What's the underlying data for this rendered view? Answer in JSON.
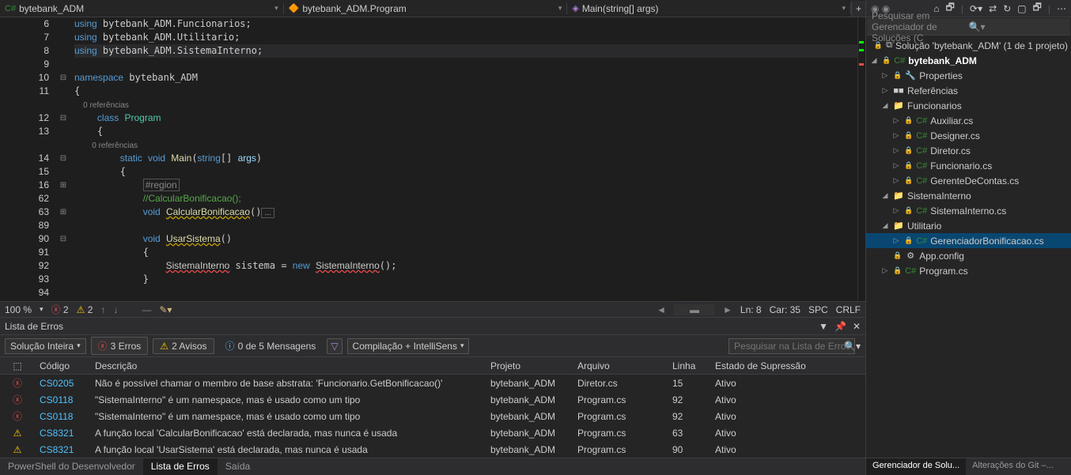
{
  "nav": {
    "project": "bytebank_ADM",
    "class": "bytebank_ADM.Program",
    "method": "Main(string[] args)"
  },
  "editor": {
    "lines": [
      {
        "n": 6,
        "t": "using bytebank_ADM.Funcionarios;",
        "k": "using"
      },
      {
        "n": 7,
        "t": "using bytebank_ADM.Utilitario;",
        "k": "using"
      },
      {
        "n": 8,
        "t": "using bytebank_ADM.SistemaInterno;",
        "k": "using",
        "cur": true,
        "bulb": true
      },
      {
        "n": 9,
        "t": ""
      },
      {
        "n": 10,
        "t": "namespace bytebank_ADM",
        "k": "ns"
      },
      {
        "n": 11,
        "t": "{"
      },
      {
        "n": "",
        "t": "    0 referências",
        "ref": true
      },
      {
        "n": 12,
        "t": "    class Program",
        "k": "cls"
      },
      {
        "n": 13,
        "t": "    {"
      },
      {
        "n": "",
        "t": "        0 referências",
        "ref": true
      },
      {
        "n": 14,
        "t": "        static void Main(string[] args)",
        "k": "meth"
      },
      {
        "n": 15,
        "t": "        {"
      },
      {
        "n": 16,
        "t": "            #region",
        "k": "reg"
      },
      {
        "n": 62,
        "t": "            //CalcularBonificacao();",
        "k": "com"
      },
      {
        "n": 63,
        "t": "            void CalcularBonificacao()...",
        "k": "lf"
      },
      {
        "n": 89,
        "t": ""
      },
      {
        "n": 90,
        "t": "            void UsarSistema()",
        "k": "lf2"
      },
      {
        "n": 91,
        "t": "            {"
      },
      {
        "n": 92,
        "t": "                SistemaInterno sistema = new SistemaInterno();",
        "k": "decl"
      },
      {
        "n": 93,
        "t": "            }"
      },
      {
        "n": 94,
        "t": ""
      }
    ]
  },
  "status": {
    "zoom": "100 %",
    "errors": "2",
    "warnings": "2",
    "ln": "Ln: 8",
    "col": "Car: 35",
    "spc": "SPC",
    "crlf": "CRLF"
  },
  "errorList": {
    "title": "Lista de Erros",
    "scope": "Solução Inteira",
    "btnErr": "3 Erros",
    "btnWarn": "2 Avisos",
    "btnMsg": "0 de 5 Mensagens",
    "build": "Compilação + IntelliSens",
    "searchPH": "Pesquisar na Lista de Erros",
    "cols": {
      "code": "Código",
      "desc": "Descrição",
      "proj": "Projeto",
      "file": "Arquivo",
      "line": "Linha",
      "state": "Estado de Supressão"
    },
    "rows": [
      {
        "ico": "err",
        "code": "CS0205",
        "desc": "Não é possível chamar o membro de base abstrata: 'Funcionario.GetBonificacao()'",
        "proj": "bytebank_ADM",
        "file": "Diretor.cs",
        "line": "15",
        "state": "Ativo"
      },
      {
        "ico": "err",
        "code": "CS0118",
        "desc": "\"SistemaInterno\" é um namespace, mas é usado como um tipo",
        "proj": "bytebank_ADM",
        "file": "Program.cs",
        "line": "92",
        "state": "Ativo"
      },
      {
        "ico": "err",
        "code": "CS0118",
        "desc": "\"SistemaInterno\" é um namespace, mas é usado como um tipo",
        "proj": "bytebank_ADM",
        "file": "Program.cs",
        "line": "92",
        "state": "Ativo"
      },
      {
        "ico": "warn",
        "code": "CS8321",
        "desc": "A função local 'CalcularBonificacao' está declarada, mas nunca é usada",
        "proj": "bytebank_ADM",
        "file": "Program.cs",
        "line": "63",
        "state": "Ativo"
      },
      {
        "ico": "warn",
        "code": "CS8321",
        "desc": "A função local 'UsarSistema' está declarada, mas nunca é usada",
        "proj": "bytebank_ADM",
        "file": "Program.cs",
        "line": "90",
        "state": "Ativo"
      }
    ]
  },
  "bottomTabs": {
    "t1": "PowerShell do Desenvolvedor",
    "t2": "Lista de Erros",
    "t3": "Saída"
  },
  "solution": {
    "searchPH": "Pesquisar em Gerenciador de Soluções (C",
    "root": "Solução 'bytebank_ADM' (1 de 1 projeto)",
    "proj": "bytebank_ADM",
    "props": "Properties",
    "refs": "Referências",
    "f1": "Funcionarios",
    "f1items": [
      "Auxiliar.cs",
      "Designer.cs",
      "Diretor.cs",
      "Funcionario.cs",
      "GerenteDeContas.cs"
    ],
    "f2": "SistemaInterno",
    "f2items": [
      "SistemaInterno.cs"
    ],
    "f3": "Utilitario",
    "f3items": [
      "GerenciadorBonificacao.cs"
    ],
    "app": "App.config",
    "prog": "Program.cs",
    "tab1": "Gerenciador de Solu...",
    "tab2": "Alterações do Git –..."
  }
}
